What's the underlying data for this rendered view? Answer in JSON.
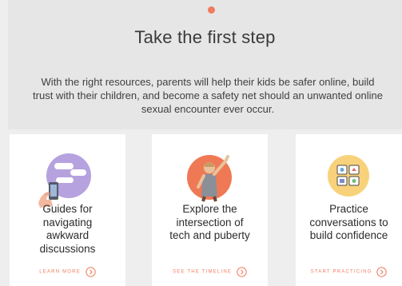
{
  "colors": {
    "accent": "#f07c5e",
    "hero_bg": "#e6e6e6",
    "page_bg": "#eeeeee",
    "card_bg": "#ffffff",
    "purple": "#b6a2de",
    "orange": "#ef7955",
    "yellow": "#f8d27a"
  },
  "hero": {
    "title": "Take the first step",
    "text": "With the right resources, parents will help their kids be safer online, build trust with their children, and become a safety net should an unwanted online sexual encounter ever occur."
  },
  "cards": [
    {
      "title_lines": [
        "Guides for",
        "navigating",
        "awkward",
        "discussions"
      ],
      "link": "LEARN MORE",
      "icon": "hand-phone-chat-icon"
    },
    {
      "title_lines": [
        "Explore the",
        "intersection of",
        "tech and puberty"
      ],
      "link": "SEE THE TIMELINE",
      "icon": "child-reaching-icon"
    },
    {
      "title_lines": [
        "Practice",
        "conversations to",
        "build confidence"
      ],
      "link": "START PRACTICING",
      "icon": "app-grid-icon"
    }
  ]
}
